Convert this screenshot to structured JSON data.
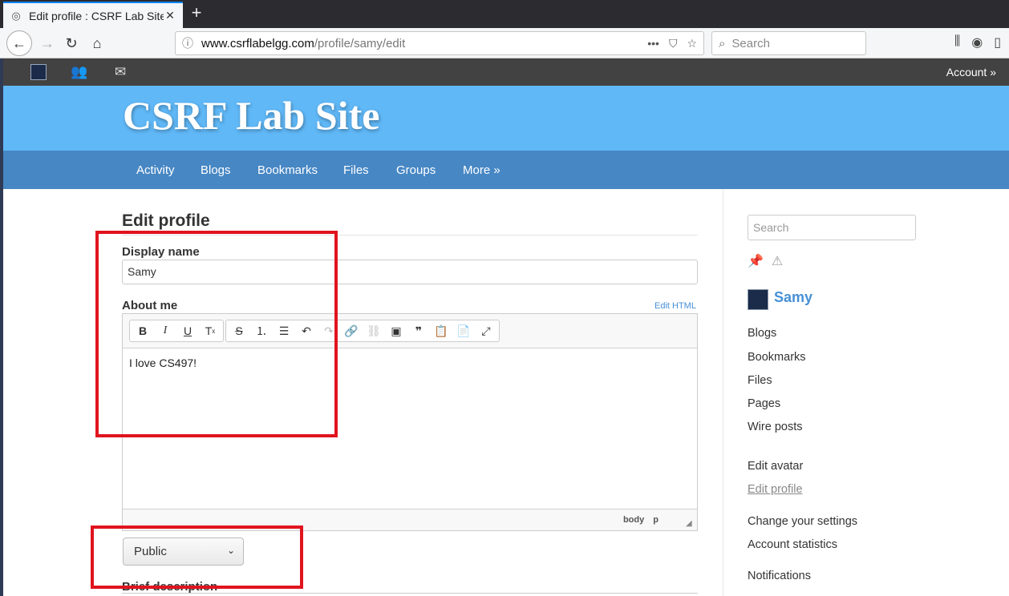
{
  "browser": {
    "tab_title": "Edit profile : CSRF Lab Site",
    "tab_close": "✕",
    "new_tab": "+",
    "url_host": "www.csrflabelgg.com",
    "url_path": "/profile/samy/edit",
    "url_actions": "•••",
    "search_placeholder": "Search"
  },
  "topbar": {
    "account_label": "Account »"
  },
  "site": {
    "title": "CSRF Lab Site",
    "menu": [
      "Activity",
      "Blogs",
      "Bookmarks",
      "Files",
      "Groups",
      "More »"
    ]
  },
  "form": {
    "heading": "Edit profile",
    "display_name_label": "Display name",
    "display_name_value": "Samy",
    "about_label": "About me",
    "edit_html": "Edit HTML",
    "about_value": "I love CS497!",
    "editor_path": "body p",
    "access_value": "Public",
    "brief_label": "Brief description"
  },
  "sidebar": {
    "search_placeholder": "Search",
    "owner_name": "Samy",
    "links": [
      "Blogs",
      "Bookmarks",
      "Files",
      "Pages",
      "Wire posts",
      "Edit avatar",
      "Edit profile",
      "Change your settings",
      "Account statistics",
      "Notifications"
    ]
  },
  "colors": {
    "header_bg": "#60b8f7",
    "menu_bg": "#4787c4",
    "link": "#4690d6",
    "highlight": "#e0141e"
  }
}
